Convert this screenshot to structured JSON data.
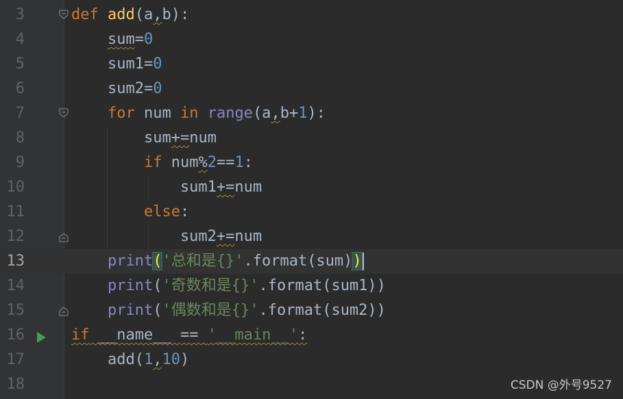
{
  "editor": {
    "lines": [
      {
        "num": "3",
        "segments": [
          {
            "t": "def ",
            "c": "kw"
          },
          {
            "t": "add",
            "c": "fn"
          },
          {
            "t": "(a"
          },
          {
            "t": ",",
            "c": "squig"
          },
          {
            "t": "b):"
          }
        ]
      },
      {
        "num": "4",
        "segments": [
          {
            "t": "    "
          },
          {
            "t": "sum",
            "c": "squig"
          },
          {
            "t": "="
          },
          {
            "t": "0",
            "c": "num"
          }
        ]
      },
      {
        "num": "5",
        "segments": [
          {
            "t": "    sum1="
          },
          {
            "t": "0",
            "c": "num"
          }
        ]
      },
      {
        "num": "6",
        "segments": [
          {
            "t": "    sum2="
          },
          {
            "t": "0",
            "c": "num"
          }
        ]
      },
      {
        "num": "7",
        "segments": [
          {
            "t": "    "
          },
          {
            "t": "for ",
            "c": "kw"
          },
          {
            "t": "num "
          },
          {
            "t": "in ",
            "c": "kw"
          },
          {
            "t": "range",
            "c": "bi"
          },
          {
            "t": "(a"
          },
          {
            "t": ",",
            "c": "squig"
          },
          {
            "t": "b+"
          },
          {
            "t": "1",
            "c": "num"
          },
          {
            "t": "):"
          }
        ]
      },
      {
        "num": "8",
        "segments": [
          {
            "t": "        sum"
          },
          {
            "t": "+=",
            "c": "squig"
          },
          {
            "t": "num"
          }
        ]
      },
      {
        "num": "9",
        "segments": [
          {
            "t": "        "
          },
          {
            "t": "if ",
            "c": "kw"
          },
          {
            "t": "num"
          },
          {
            "t": "%",
            "c": "squig"
          },
          {
            "t": "2",
            "c": "num"
          },
          {
            "t": "=="
          },
          {
            "t": "1",
            "c": "num"
          },
          {
            "t": ":"
          }
        ]
      },
      {
        "num": "10",
        "segments": [
          {
            "t": "            sum1"
          },
          {
            "t": "+=",
            "c": "squig"
          },
          {
            "t": "num"
          }
        ]
      },
      {
        "num": "11",
        "segments": [
          {
            "t": "        "
          },
          {
            "t": "else",
            "c": "kw"
          },
          {
            "t": ":"
          }
        ]
      },
      {
        "num": "12",
        "segments": [
          {
            "t": "            sum2"
          },
          {
            "t": "+=",
            "c": "squig"
          },
          {
            "t": "num"
          }
        ]
      },
      {
        "num": "13",
        "current": true,
        "segments": [
          {
            "t": "    "
          },
          {
            "t": "print",
            "c": "bi"
          },
          {
            "t": "(",
            "c": "paren-hl"
          },
          {
            "t": "'",
            "c": "str"
          },
          {
            "t": "总和是",
            "c": "str cjk"
          },
          {
            "t": "{}'",
            "c": "str"
          },
          {
            "t": ".format(sum)"
          },
          {
            "t": ")",
            "c": "paren-hl"
          }
        ]
      },
      {
        "num": "14",
        "segments": [
          {
            "t": "    "
          },
          {
            "t": "print",
            "c": "bi"
          },
          {
            "t": "("
          },
          {
            "t": "'",
            "c": "str"
          },
          {
            "t": "奇数和是",
            "c": "str cjk"
          },
          {
            "t": "{}'",
            "c": "str"
          },
          {
            "t": ".format(sum1))"
          }
        ]
      },
      {
        "num": "15",
        "segments": [
          {
            "t": "    "
          },
          {
            "t": "print",
            "c": "bi"
          },
          {
            "t": "("
          },
          {
            "t": "'",
            "c": "str"
          },
          {
            "t": "偶数和是",
            "c": "str cjk"
          },
          {
            "t": "{}'",
            "c": "str"
          },
          {
            "t": ".format(sum2))"
          }
        ]
      },
      {
        "num": "16",
        "segments": [
          {
            "t": "if __name__ == '__main__':",
            "c": "squig mixed16"
          }
        ]
      },
      {
        "num": "17",
        "segments": [
          {
            "t": "    add("
          },
          {
            "t": "1",
            "c": "num"
          },
          {
            "t": ",",
            "c": "squig"
          },
          {
            "t": "10",
            "c": "num"
          },
          {
            "t": ")"
          }
        ]
      },
      {
        "num": "18",
        "segments": []
      }
    ]
  },
  "watermark": "CSDN @外号9527"
}
